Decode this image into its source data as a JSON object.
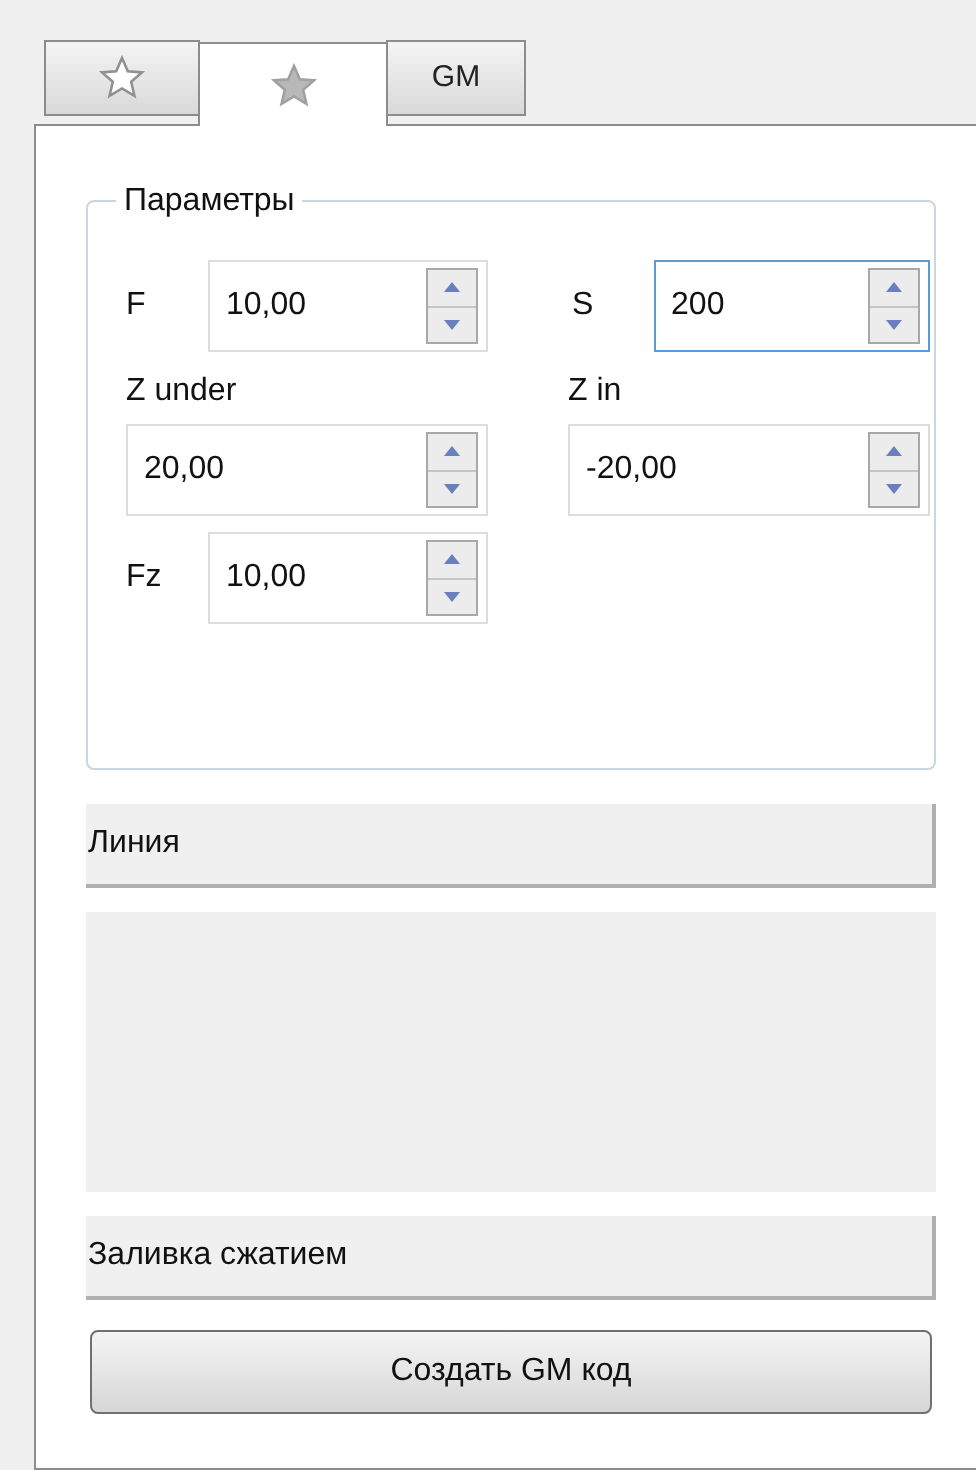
{
  "tabs": [
    {
      "kind": "star-outline",
      "selected": false
    },
    {
      "kind": "star-filled",
      "selected": true
    },
    {
      "kind": "text",
      "label": "GM",
      "selected": false
    }
  ],
  "parameters": {
    "title": "Параметры",
    "fields": [
      {
        "kind": "inline",
        "label": "F",
        "value": "10,00",
        "focused": false
      },
      {
        "kind": "inline",
        "label": "S",
        "value": "200",
        "focused": true
      },
      {
        "kind": "stacked",
        "label": "Z under",
        "value": "20,00",
        "focused": false
      },
      {
        "kind": "stacked",
        "label": "Z in",
        "value": "-20,00",
        "focused": false
      },
      {
        "kind": "inline",
        "label": "Fz",
        "value": "10,00",
        "focused": false
      }
    ]
  },
  "sections": [
    {
      "title": "Линия",
      "kind": "header"
    },
    {
      "kind": "empty"
    },
    {
      "title": "Заливка сжатием",
      "kind": "header"
    }
  ],
  "button": "Создать GM код"
}
